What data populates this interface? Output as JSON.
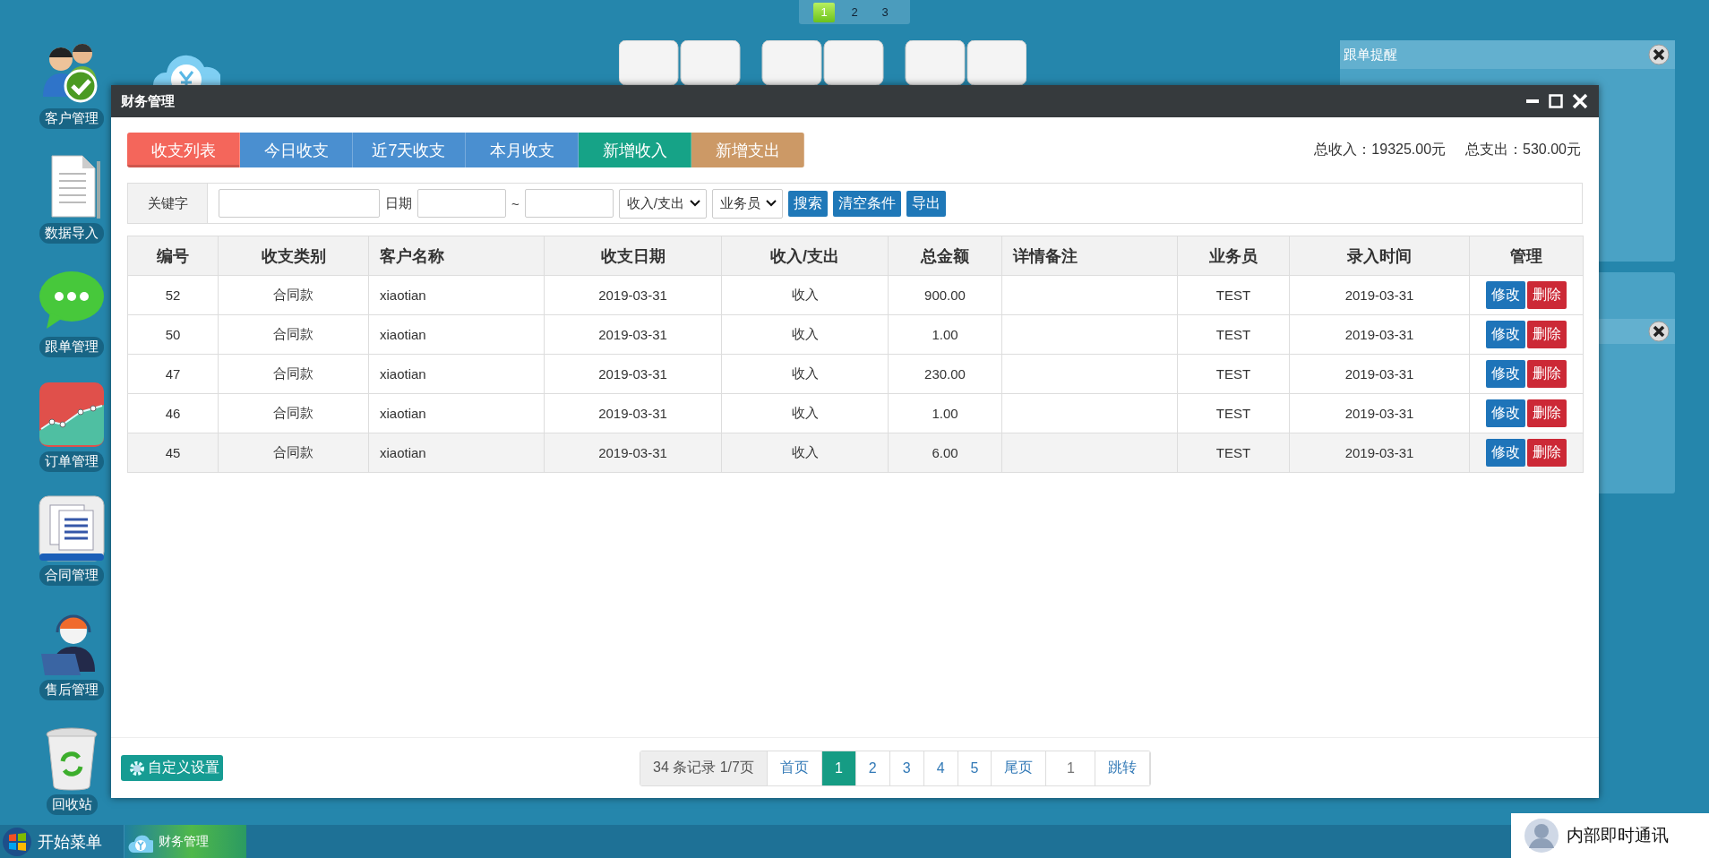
{
  "page_switcher": [
    {
      "label": "1",
      "selected": true
    },
    {
      "label": "2",
      "selected": false
    },
    {
      "label": "3",
      "selected": false
    }
  ],
  "desktop_icons": [
    {
      "kind": "users",
      "label": "客户管理"
    },
    {
      "kind": "document",
      "label": "数据导入"
    },
    {
      "kind": "chat",
      "label": "跟单管理"
    },
    {
      "kind": "chart",
      "label": "订单管理"
    },
    {
      "kind": "contract",
      "label": "合同管理"
    },
    {
      "kind": "support",
      "label": "售后管理"
    },
    {
      "kind": "recycle",
      "label": "回收站"
    }
  ],
  "notices": [
    {
      "kind": "full",
      "title": "跟单提醒"
    },
    {
      "kind": "collapsed"
    }
  ],
  "window": {
    "title": "财务管理",
    "tabs": [
      {
        "label": "收支列表",
        "color": "#f4665b",
        "selected": true
      },
      {
        "label": "今日收支",
        "color": "#4a8fd0",
        "selected": false
      },
      {
        "label": "近7天收支",
        "color": "#4a8fd0",
        "selected": false
      },
      {
        "label": "本月收支",
        "color": "#4a8fd0",
        "selected": false
      },
      {
        "label": "新增收入",
        "color": "#16a387",
        "selected": false
      },
      {
        "label": "新增支出",
        "color": "#cc9966",
        "selected": false
      }
    ],
    "totals": [
      "总收入：19325.00元",
      "总支出：530.00元"
    ],
    "filters": {
      "keyword_label": "关键字",
      "date_label": "日期",
      "range_separator": "~",
      "type_select": "收入/支出",
      "staff_select": "业务员",
      "buttons": [
        "搜索",
        "清空条件",
        "导出"
      ]
    },
    "table": {
      "columns": [
        "编号",
        "收支类别",
        "客户名称",
        "收支日期",
        "收入/支出",
        "总金额",
        "详情备注",
        "业务员",
        "录入时间",
        "管理"
      ],
      "rows": [
        {
          "highlighted": false,
          "cells": [
            "52",
            "合同款",
            "xiaotian",
            "2019-03-31",
            "收入",
            "900.00",
            "",
            "TEST",
            "2019-03-31"
          ],
          "actions": [
            "修改",
            "删除"
          ]
        },
        {
          "highlighted": false,
          "cells": [
            "50",
            "合同款",
            "xiaotian",
            "2019-03-31",
            "收入",
            "1.00",
            "",
            "TEST",
            "2019-03-31"
          ],
          "actions": [
            "修改",
            "删除"
          ]
        },
        {
          "highlighted": false,
          "cells": [
            "47",
            "合同款",
            "xiaotian",
            "2019-03-31",
            "收入",
            "230.00",
            "",
            "TEST",
            "2019-03-31"
          ],
          "actions": [
            "修改",
            "删除"
          ]
        },
        {
          "highlighted": false,
          "cells": [
            "46",
            "合同款",
            "xiaotian",
            "2019-03-31",
            "收入",
            "1.00",
            "",
            "TEST",
            "2019-03-31"
          ],
          "actions": [
            "修改",
            "删除"
          ]
        },
        {
          "highlighted": true,
          "cells": [
            "45",
            "合同款",
            "xiaotian",
            "2019-03-31",
            "收入",
            "6.00",
            "",
            "TEST",
            "2019-03-31"
          ],
          "actions": [
            "修改",
            "删除"
          ]
        }
      ]
    },
    "settings_button": "自定义设置",
    "pagination": {
      "summary": "34 条记录 1/7页",
      "items": [
        {
          "label": "首页",
          "selected": false
        },
        {
          "label": "1",
          "selected": true
        },
        {
          "label": "2",
          "selected": false
        },
        {
          "label": "3",
          "selected": false
        },
        {
          "label": "4",
          "selected": false
        },
        {
          "label": "5",
          "selected": false
        },
        {
          "label": "尾页",
          "selected": false
        }
      ],
      "jump_value": "1",
      "jump_button": "跳转"
    }
  },
  "taskbar": {
    "start": "开始菜单",
    "tasks": [
      {
        "label": "财务管理",
        "selected": true
      }
    ],
    "messenger": "内部即时通讯"
  }
}
